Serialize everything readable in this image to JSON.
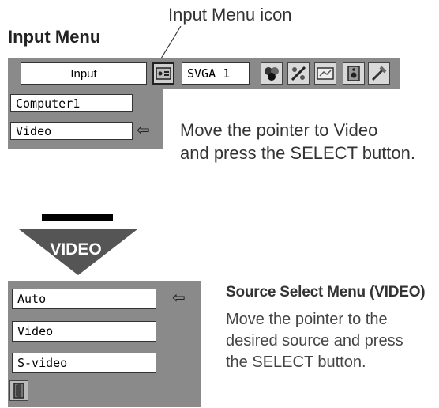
{
  "callout": {
    "label": "Input Menu icon"
  },
  "heading": "Input Menu",
  "menu_bar": {
    "input_label": "Input",
    "mode_label": "SVGA 1",
    "icons": [
      "input-menu-icon",
      "color-icon",
      "image-adjust-icon",
      "screen-icon",
      "sound-icon",
      "setting-icon"
    ]
  },
  "input_submenu": {
    "items": [
      {
        "label": "Computer1"
      },
      {
        "label": "Video",
        "pointer": "⇦"
      }
    ]
  },
  "instruction_1": {
    "line1": "Move the pointer to Video",
    "line2": "and press the SELECT button."
  },
  "arrow_label": "VIDEO",
  "source_menu": {
    "title": "Source Select Menu (VIDEO)",
    "items": [
      {
        "label": "Auto",
        "pointer": "⇦"
      },
      {
        "label": "Video"
      },
      {
        "label": "S-video"
      }
    ],
    "exit_icon": "exit-door-icon",
    "instruction": {
      "line1": "Move the pointer to the",
      "line2": "desired source and press",
      "line3": "the SELECT button."
    }
  }
}
